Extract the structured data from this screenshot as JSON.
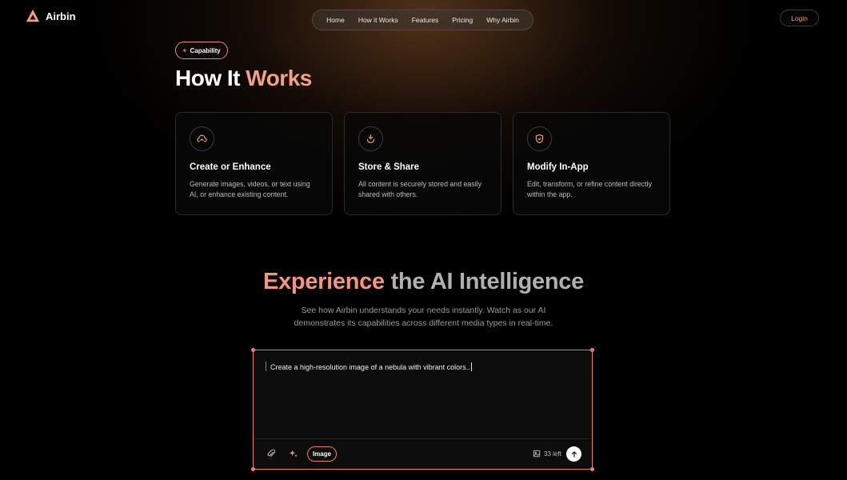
{
  "brand": {
    "name": "Airbin",
    "accent": "#f5a27c"
  },
  "nav": {
    "items": [
      "Home",
      "How it Works",
      "Features",
      "Pricing",
      "Why Airbin"
    ]
  },
  "login_label": "Login",
  "capability": {
    "plus": "+",
    "label": "Capability"
  },
  "how_it_works": {
    "title_part1": "How It ",
    "title_part2": "Works",
    "cards": [
      {
        "icon": "cloud-sync-icon",
        "title": "Create or Enhance",
        "description": "Generate images, videos, or text using AI, or enhance existing content."
      },
      {
        "icon": "download-store-icon",
        "title": "Store & Share",
        "description": "All content is securely stored and easily shared with others."
      },
      {
        "icon": "shield-edit-icon",
        "title": "Modify In-App",
        "description": "Edit, transform, or refine content directly within the app."
      }
    ]
  },
  "experience": {
    "title_part1": "Experience",
    "title_part2": " the AI Intelligence",
    "subtitle_line1": "See how Airbin understands your needs instantly. Watch as our AI",
    "subtitle_line2": "demonstrates its capabilities across different media types in real-time."
  },
  "chat": {
    "prompt": "Create a high-resolution image of a nebula with vibrant colors..",
    "mode_label": "Image",
    "remaining": "33 left",
    "icons": [
      "paperclip-icon",
      "sparkle-icon",
      "image-icon",
      "send-arrow-icon"
    ]
  }
}
